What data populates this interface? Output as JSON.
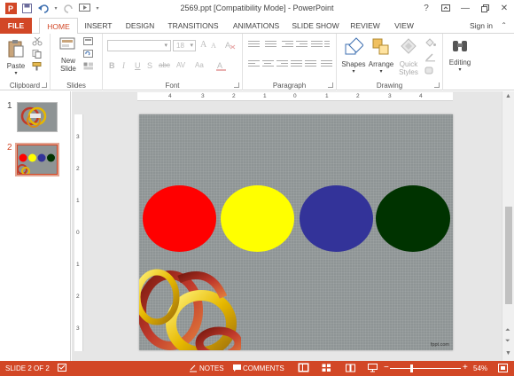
{
  "titlebar": {
    "title": "2569.ppt [Compatibility Mode] - PowerPoint",
    "help": "?",
    "minimize": "—",
    "close": "✕"
  },
  "tabs": {
    "file": "FILE",
    "items": [
      "HOME",
      "INSERT",
      "DESIGN",
      "TRANSITIONS",
      "ANIMATIONS",
      "SLIDE SHOW",
      "REVIEW",
      "VIEW"
    ],
    "active": "HOME",
    "signin": "Sign in"
  },
  "ribbon": {
    "groups": {
      "clipboard": "Clipboard",
      "slides": "Slides",
      "font": "Font",
      "paragraph": "Paragraph",
      "drawing": "Drawing"
    },
    "paste": "Paste",
    "new_slide_1": "New",
    "new_slide_2": "Slide",
    "font_size": "18",
    "shapes": "Shapes",
    "arrange": "Arrange",
    "quick_styles_1": "Quick",
    "quick_styles_2": "Styles",
    "editing": "Editing",
    "bold": "B",
    "italic": "I",
    "underline": "U",
    "strike": "S",
    "shadow": "abc",
    "spacing": "AV",
    "case": "Aa",
    "grow": "A",
    "shrink": "A"
  },
  "thumbnails": {
    "items": [
      {
        "number": "1"
      },
      {
        "number": "2"
      }
    ],
    "selected_number": "2"
  },
  "ruler": {
    "horizontal": [
      "4",
      "3",
      "2",
      "1",
      "0",
      "1",
      "2",
      "3",
      "4"
    ],
    "vertical": [
      "3",
      "2",
      "1",
      "0",
      "1",
      "2",
      "3"
    ]
  },
  "slide": {
    "background": "#8e9495",
    "circles": [
      {
        "color": "#ff0000",
        "name": "red"
      },
      {
        "color": "#ffff00",
        "name": "yellow"
      },
      {
        "color": "#333399",
        "name": "blue"
      },
      {
        "color": "#003300",
        "name": "dark-green"
      }
    ],
    "watermark": "fppt.com"
  },
  "statusbar": {
    "slide_info": "SLIDE 2 OF 2",
    "notes": "NOTES",
    "comments": "COMMENTS",
    "zoom": "54%",
    "minus": "−",
    "plus": "+"
  },
  "colors": {
    "accent": "#d24726"
  }
}
